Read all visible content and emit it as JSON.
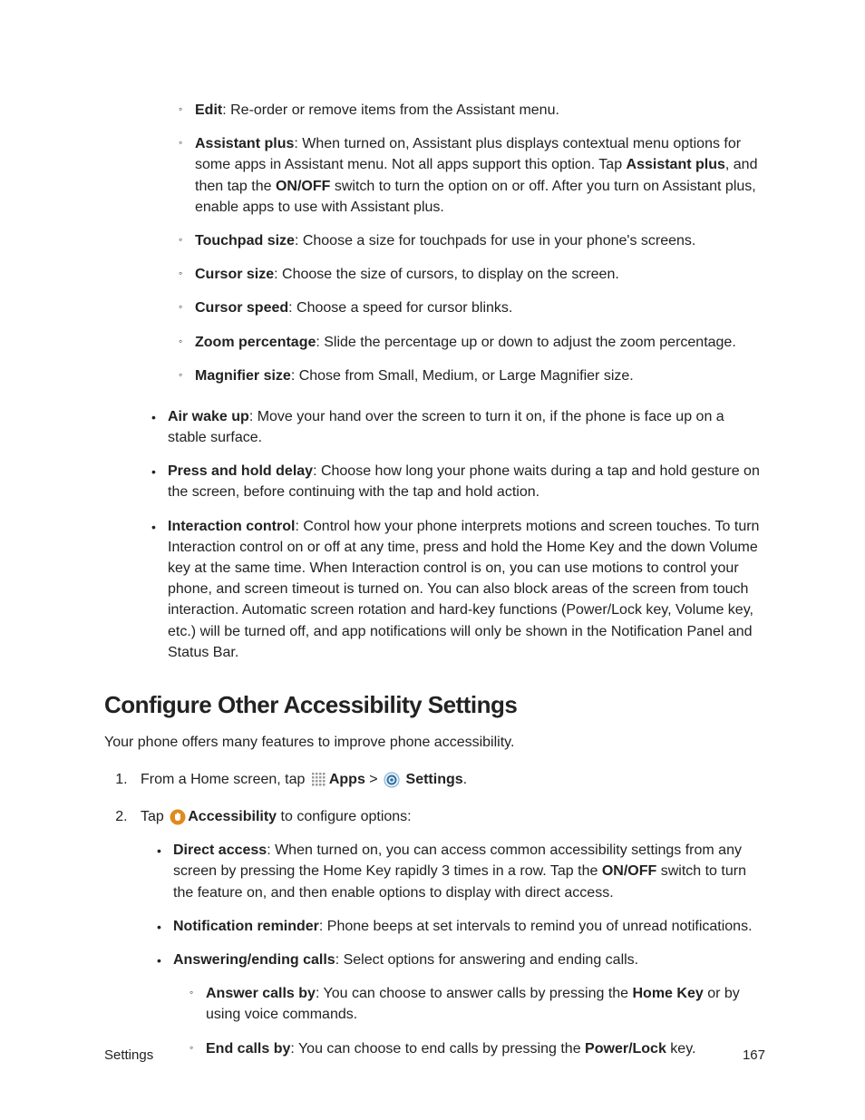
{
  "sublist_top": [
    {
      "term": "Edit",
      "desc": ": Re-order or remove items from the Assistant menu."
    },
    {
      "term": "Assistant plus",
      "desc_pre": ": When turned on, Assistant plus displays contextual menu options for some apps in Assistant menu. Not all apps support this option. Tap ",
      "bold_mid": "Assistant plus",
      "desc_mid": ", and then tap the ",
      "bold_mid2": "ON/OFF",
      "desc_post": " switch to turn the option on or off. After you turn on Assistant plus, enable apps to use with Assistant plus."
    },
    {
      "term": "Touchpad size",
      "desc": ": Choose a size for touchpads for use in your phone's screens."
    },
    {
      "term": "Cursor size",
      "desc": ": Choose the size of cursors, to display on the screen."
    },
    {
      "term": "Cursor speed",
      "desc": ": Choose a speed for cursor blinks."
    },
    {
      "term": "Zoom percentage",
      "desc": ": Slide the percentage up or down to adjust the zoom percentage."
    },
    {
      "term": "Magnifier size",
      "desc": ": Chose from Small, Medium, or Large Magnifier size."
    }
  ],
  "list_mid": [
    {
      "term": "Air wake up",
      "desc": ": Move your hand over the screen to turn it on, if the phone is face up on a stable surface."
    },
    {
      "term": "Press and hold delay",
      "desc": ": Choose how long your phone waits during a tap and hold gesture on the screen, before continuing with the tap and hold action."
    },
    {
      "term": "Interaction control",
      "desc": ": Control how your phone interprets motions and screen touches. To turn Interaction control on or off at any time, press and hold the Home Key and the down Volume key at the same time. When Interaction control is on, you can use motions to control your phone, and screen timeout is turned on. You can also block areas of the screen from touch interaction. Automatic screen rotation and hard-key functions (Power/Lock key, Volume key, etc.) will be turned off, and app notifications will only be shown in the Notification Panel and Status Bar."
    }
  ],
  "section_heading": "Configure Other Accessibility Settings",
  "section_intro": "Your phone offers many features to improve phone accessibility.",
  "step1": {
    "pre": "From a Home screen, tap ",
    "apps": "Apps",
    "gt": " > ",
    "settings": "Settings",
    "post": "."
  },
  "step2": {
    "pre": "Tap ",
    "acc": "Accessibility",
    "post": " to configure options:"
  },
  "step2_list": [
    {
      "term": "Direct access",
      "desc_pre": ": When turned on, you can access common accessibility settings from any screen by pressing the Home Key rapidly 3 times in a row. Tap the ",
      "bold_mid": "ON/OFF",
      "desc_post": " switch to turn the feature on, and then enable options to display with direct access."
    },
    {
      "term": "Notification reminder",
      "desc": ": Phone beeps at set intervals to remind you of unread notifications."
    },
    {
      "term": "Answering/ending calls",
      "desc": ": Select options for answering and ending calls."
    }
  ],
  "step2_sublist": [
    {
      "term": "Answer calls by",
      "desc_pre": ": You can choose to answer calls by pressing the ",
      "bold_mid": "Home Key",
      "desc_post": " or by using voice commands."
    },
    {
      "term": "End calls by",
      "desc_pre": ": You can choose to end calls by pressing the ",
      "bold_mid": "Power/Lock",
      "desc_post": " key."
    }
  ],
  "footer": {
    "left": "Settings",
    "right": "167"
  }
}
